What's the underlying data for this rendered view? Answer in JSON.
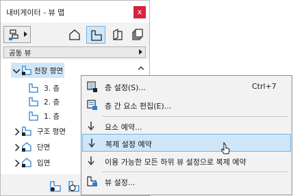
{
  "window": {
    "title": "내비게이터 - 뷰 맵",
    "close_glyph": "x"
  },
  "toolbar": {
    "popup_icon": "view-map-icon",
    "modes": [
      {
        "icon": "project-map-icon",
        "active": false
      },
      {
        "icon": "view-map-icon",
        "active": true
      },
      {
        "icon": "layout-book-icon",
        "active": false
      },
      {
        "icon": "publisher-sets-icon",
        "active": false
      }
    ]
  },
  "dropdown": {
    "value": "공동 뷰"
  },
  "tree": {
    "items": [
      {
        "label": "천장 평면",
        "expanded": true,
        "selected": true
      },
      {
        "label": "3. 층"
      },
      {
        "label": "2. 층"
      },
      {
        "label": "1. 층"
      },
      {
        "label": "구조 평면",
        "expanded": false
      },
      {
        "label": "단면",
        "expanded": false
      },
      {
        "label": "입면",
        "expanded": false
      }
    ]
  },
  "context_menu": {
    "items": [
      {
        "label": "층 설정(S)...",
        "shortcut": "Ctrl+7",
        "icon": "story-settings-icon"
      },
      {
        "label": "층 간 요소 편집(E)...",
        "shortcut": "",
        "icon": "edit-elements-by-stories-icon"
      },
      {
        "label": "요소 예약...",
        "shortcut": "",
        "icon": "reserve-down-arrow-icon"
      },
      {
        "label": "복제 설정 예약",
        "shortcut": "",
        "icon": "reserve-down-arrow-icon",
        "highlighted": true
      },
      {
        "label": "이용 가능한 모든 하위 뷰 설정으로 복제 예약",
        "shortcut": "",
        "icon": "reserve-down-arrow-icon"
      },
      {
        "label": "뷰 설정...",
        "shortcut": "",
        "icon": "view-settings-icon"
      }
    ]
  },
  "colors": {
    "accent_blue": "#2a7fd4",
    "selection": "#cfe6f8",
    "close_red": "#d7233e"
  }
}
